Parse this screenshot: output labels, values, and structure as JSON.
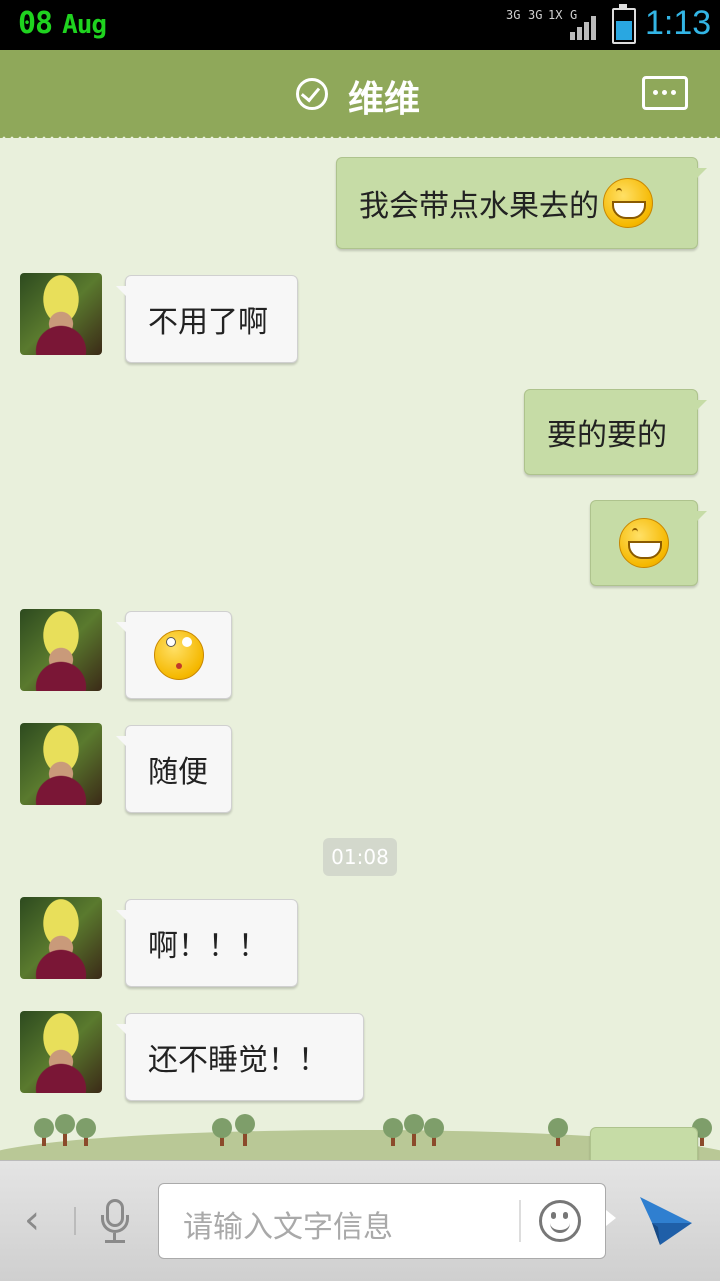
{
  "status_bar": {
    "day": "08",
    "month": "Aug",
    "network_label_1": "3G",
    "network_label_2": "3G",
    "network_label_3": "1X",
    "network_label_4": "G",
    "time": "1:13"
  },
  "header": {
    "title": "维维",
    "verified_icon": "check-circle-icon",
    "menu_icon": "chat-more-icon"
  },
  "messages": [
    {
      "side": "out",
      "text": "我会带点水果去的",
      "emoji": "grin"
    },
    {
      "side": "in",
      "text": "不用了啊"
    },
    {
      "side": "out",
      "text": "要的要的"
    },
    {
      "side": "out",
      "text": "",
      "emoji": "grin"
    },
    {
      "side": "in",
      "text": "",
      "emoji": "eye-roll"
    },
    {
      "side": "in",
      "text": "随便"
    },
    {
      "side": "in",
      "text": "啊！！！"
    },
    {
      "side": "in",
      "text": "还不睡觉！！"
    }
  ],
  "timestamp": "01:08",
  "input_bar": {
    "placeholder": "请输入文字信息",
    "back_icon": "chevron-left-icon",
    "voice_icon": "microphone-icon",
    "emoji_icon": "smiley-icon",
    "send_icon": "paper-plane-icon"
  },
  "colors": {
    "header": "#8fa85a",
    "background": "#e9f0dc",
    "outgoing_bubble": "#c6dca6",
    "incoming_bubble": "#f7f7f7",
    "send_accent": "#2f7fd0"
  }
}
